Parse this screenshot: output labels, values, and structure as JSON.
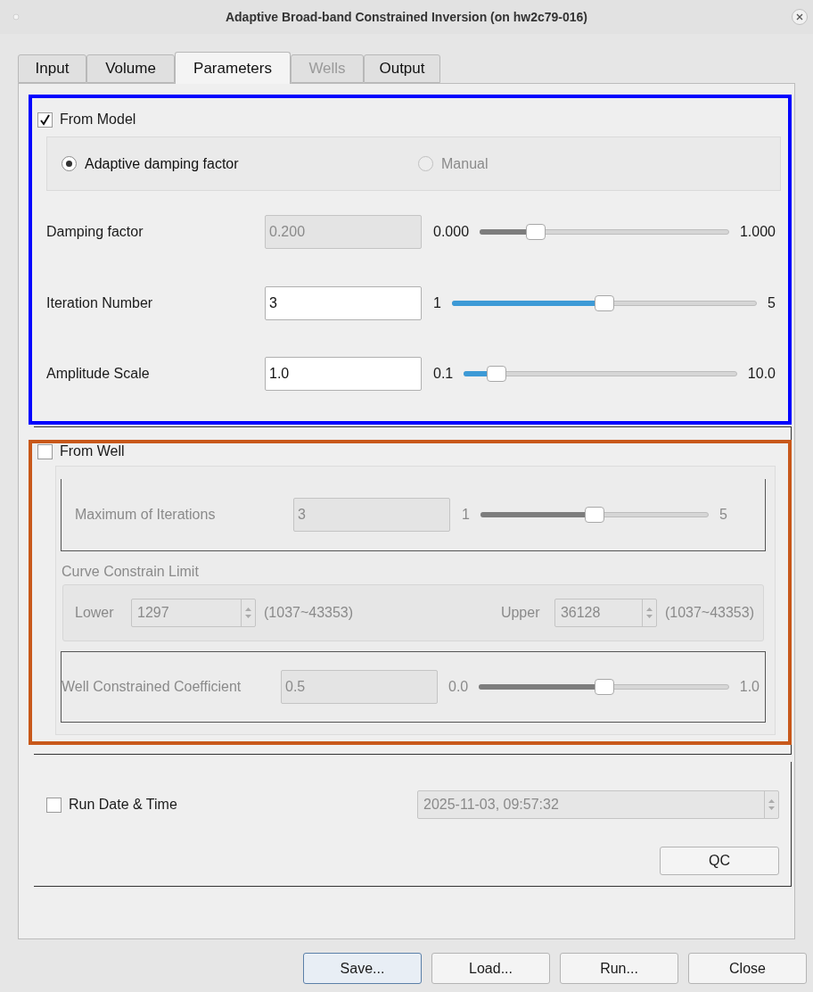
{
  "window": {
    "title": "Adaptive Broad-band Constrained Inversion (on hw2c79-016)"
  },
  "tabs": [
    {
      "label": "Input",
      "selected": false,
      "disabled": false
    },
    {
      "label": "Volume",
      "selected": false,
      "disabled": false
    },
    {
      "label": "Parameters",
      "selected": true,
      "disabled": false
    },
    {
      "label": "Wells",
      "selected": false,
      "disabled": true
    },
    {
      "label": "Output",
      "selected": false,
      "disabled": false
    }
  ],
  "from_model": {
    "label": "From Model",
    "checked": true,
    "radios": [
      {
        "label": "Adaptive damping factor",
        "selected": true,
        "disabled": false
      },
      {
        "label": "Manual",
        "selected": false,
        "disabled": true
      }
    ],
    "rows": [
      {
        "label": "Damping factor",
        "value": "0.200",
        "disabled": true,
        "min_label": "0.000",
        "max_label": "1.000",
        "level": 0.2
      },
      {
        "label": "Iteration Number",
        "value": "3",
        "disabled": false,
        "min_label": "1",
        "max_label": "5",
        "level": 0.5
      },
      {
        "label": "Amplitude Scale",
        "value": "1.0",
        "disabled": false,
        "min_label": "0.1",
        "max_label": "10.0",
        "level": 0.09
      }
    ]
  },
  "from_well": {
    "label": "From Well",
    "checked": false,
    "max_iterations": {
      "label": "Maximum of Iterations",
      "value": "3",
      "disabled": true,
      "min_label": "1",
      "max_label": "5",
      "level": 0.5
    },
    "curve_limit": {
      "title": "Curve Constrain Limit",
      "lower": {
        "label": "Lower",
        "value": "1297",
        "range": "(1037~43353)"
      },
      "upper": {
        "label": "Upper",
        "value": "36128",
        "range": "(1037~43353)"
      }
    },
    "coefficient": {
      "label": "Well Constrained Coefficient",
      "value": "0.5",
      "disabled": true,
      "min_label": "0.0",
      "max_label": "1.0",
      "level": 0.5
    }
  },
  "run_time": {
    "label": "Run Date & Time",
    "checked": false,
    "value": "2025-11-03, 09:57:32"
  },
  "qc_button": "QC",
  "buttons": [
    {
      "label": "Save...",
      "focused": true
    },
    {
      "label": "Load...",
      "focused": false
    },
    {
      "label": "Run...",
      "focused": false
    },
    {
      "label": "Close",
      "focused": false
    }
  ],
  "highlights": [
    {
      "color": "#0000ff"
    },
    {
      "color": "#c8581a"
    }
  ]
}
